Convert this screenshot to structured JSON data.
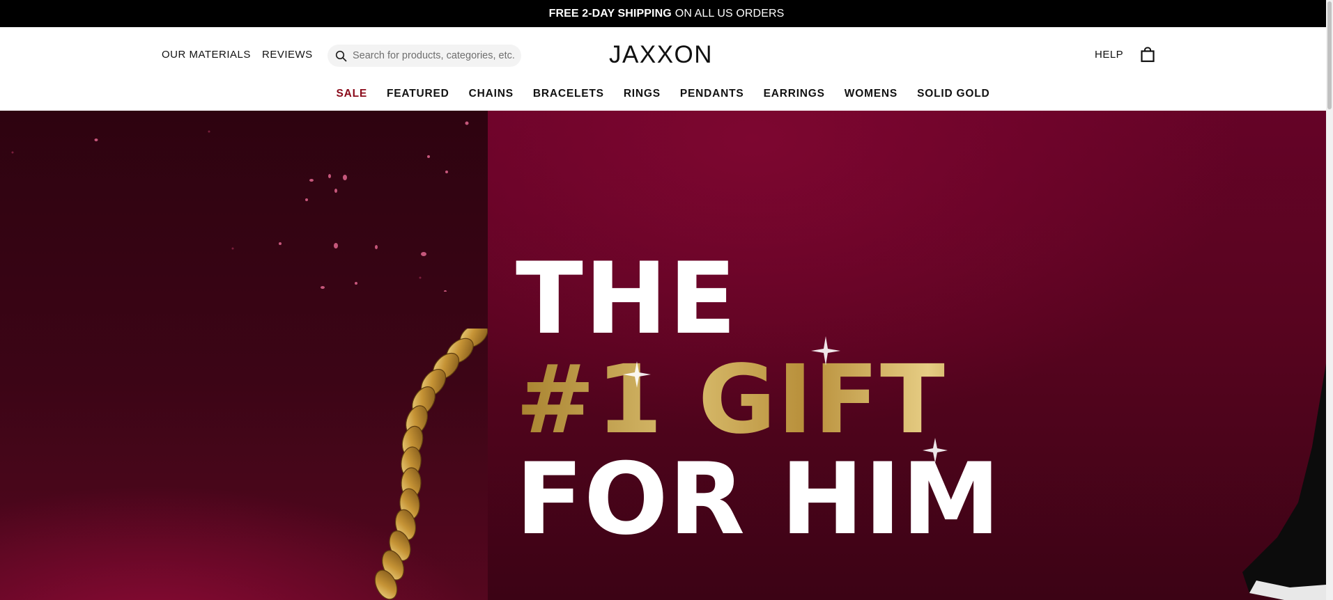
{
  "announcement": {
    "bold": "FREE 2-DAY SHIPPING",
    "rest": "ON ALL US ORDERS"
  },
  "header": {
    "left_links": [
      "OUR MATERIALS",
      "REVIEWS"
    ],
    "search_placeholder": "Search for products, categories, etc.",
    "logo": "JAXXON",
    "help": "HELP"
  },
  "menu": [
    "SALE",
    "FEATURED",
    "CHAINS",
    "BRACELETS",
    "RINGS",
    "PENDANTS",
    "EARRINGS",
    "WOMENS",
    "SOLID GOLD"
  ],
  "hero": {
    "line1": "THE",
    "line2": "#1 GIFT",
    "line3": "FOR HIM"
  },
  "colors": {
    "sale": "#8a0a1a",
    "hero_bg": "#5a0420",
    "gold": "#c9a650"
  },
  "icons": [
    "search-icon",
    "bag-icon",
    "chat-icon"
  ]
}
